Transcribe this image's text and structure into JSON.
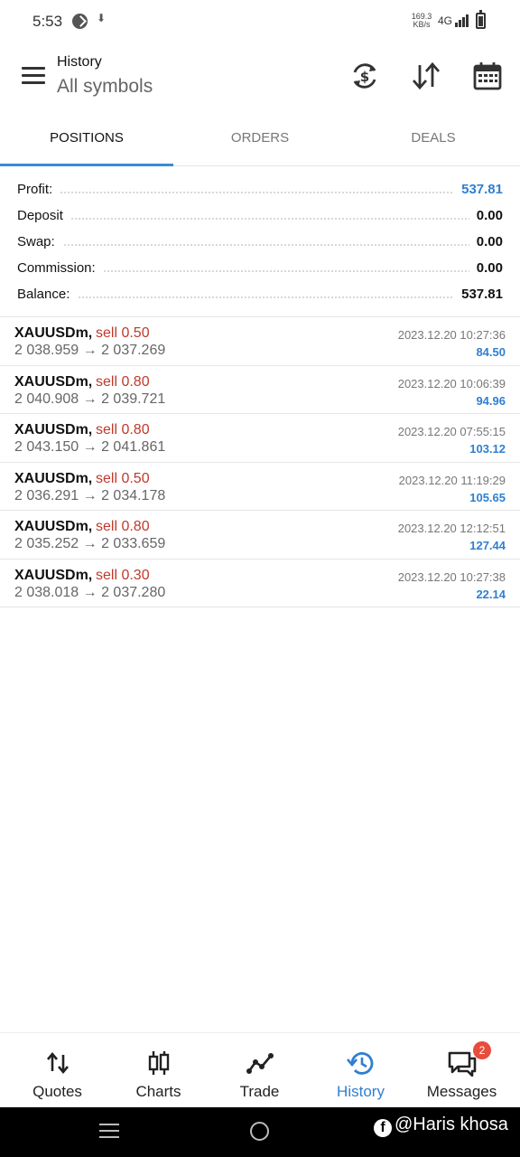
{
  "status_bar": {
    "time": "5:53",
    "net_speed_value": "169.3",
    "net_speed_unit": "KB/s",
    "network": "4G",
    "icons": [
      "vpn-icon",
      "download-arrow-icon",
      "signal-icon",
      "battery-icon"
    ]
  },
  "header": {
    "title": "History",
    "subtitle": "All symbols",
    "actions": [
      "currency-exchange-icon",
      "sort-icon",
      "calendar-icon"
    ]
  },
  "tabs": [
    {
      "label": "POSITIONS",
      "active": true
    },
    {
      "label": "ORDERS",
      "active": false
    },
    {
      "label": "DEALS",
      "active": false
    }
  ],
  "summary": {
    "profit": {
      "label": "Profit:",
      "value": "537.81"
    },
    "deposit": {
      "label": "Deposit",
      "value": "0.00"
    },
    "swap": {
      "label": "Swap:",
      "value": "0.00"
    },
    "commission": {
      "label": "Commission:",
      "value": "0.00"
    },
    "balance": {
      "label": "Balance:",
      "value": "537.81"
    }
  },
  "positions": [
    {
      "symbol": "XAUUSDm,",
      "type": "sell 0.50",
      "prices": "2 038.959 → 2 037.269",
      "time": "2023.12.20 10:27:36",
      "profit": "84.50"
    },
    {
      "symbol": "XAUUSDm,",
      "type": "sell 0.80",
      "prices": "2 040.908 → 2 039.721",
      "time": "2023.12.20 10:06:39",
      "profit": "94.96"
    },
    {
      "symbol": "XAUUSDm,",
      "type": "sell 0.80",
      "prices": "2 043.150 → 2 041.861",
      "time": "2023.12.20 07:55:15",
      "profit": "103.12"
    },
    {
      "symbol": "XAUUSDm,",
      "type": "sell 0.50",
      "prices": "2 036.291 → 2 034.178",
      "time": "2023.12.20 11:19:29",
      "profit": "105.65"
    },
    {
      "symbol": "XAUUSDm,",
      "type": "sell 0.80",
      "prices": "2 035.252 → 2 033.659",
      "time": "2023.12.20 12:12:51",
      "profit": "127.44"
    },
    {
      "symbol": "XAUUSDm,",
      "type": "sell 0.30",
      "prices": "2 038.018 → 2 037.280",
      "time": "2023.12.20 10:27:38",
      "profit": "22.14"
    }
  ],
  "bottom_nav": [
    {
      "label": "Quotes",
      "icon": "quotes-icon",
      "active": false
    },
    {
      "label": "Charts",
      "icon": "candlestick-icon",
      "active": false
    },
    {
      "label": "Trade",
      "icon": "trade-line-icon",
      "active": false
    },
    {
      "label": "History",
      "icon": "history-icon",
      "active": true
    },
    {
      "label": "Messages",
      "icon": "messages-icon",
      "active": false,
      "badge": "2"
    }
  ],
  "watermark": "@Haris khosa",
  "colors": {
    "accent": "#2f7fd1",
    "sell": "#c0392b",
    "badge": "#e74c3c"
  }
}
